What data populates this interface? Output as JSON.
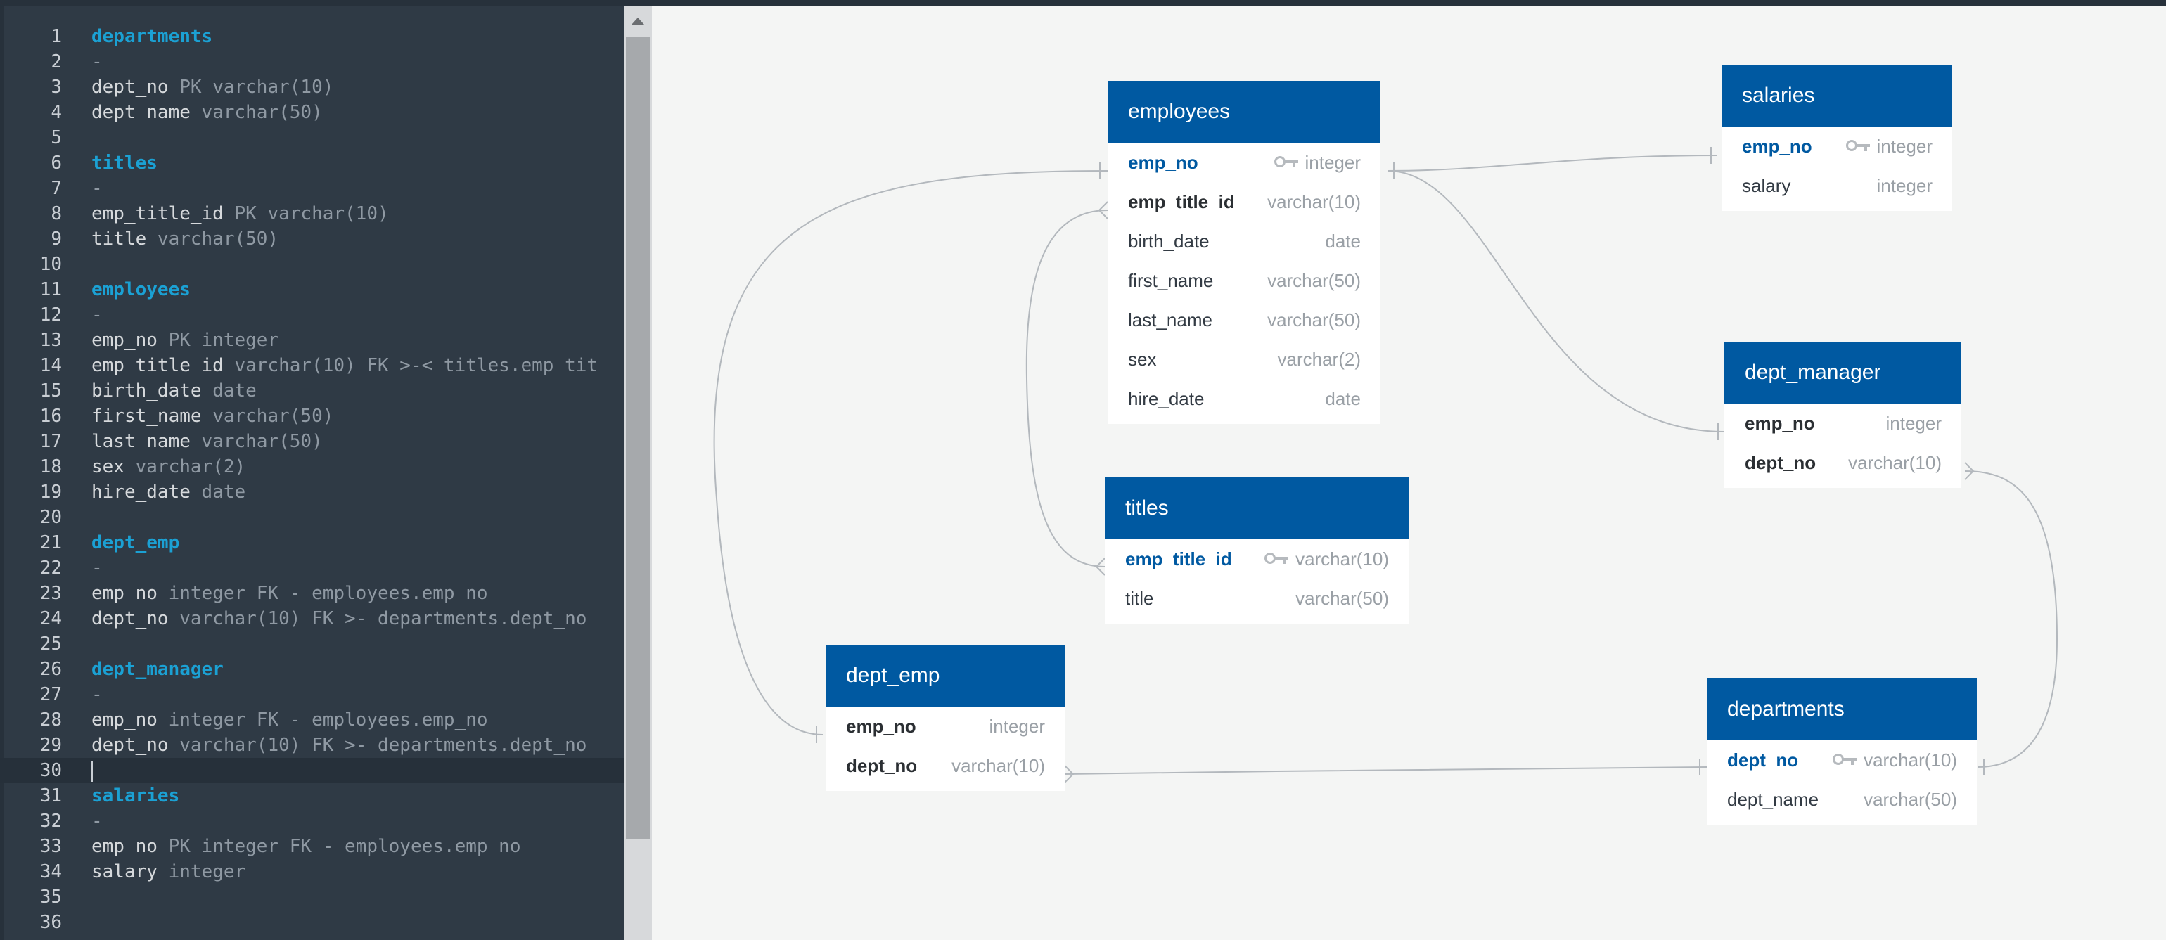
{
  "editor": {
    "lines": [
      {
        "n": "1",
        "tokens": [
          {
            "t": "departments",
            "k": "table"
          }
        ]
      },
      {
        "n": "2",
        "tokens": [
          {
            "t": "-",
            "k": "dash"
          }
        ]
      },
      {
        "n": "3",
        "tokens": [
          {
            "t": "dept_no ",
            "k": "name"
          },
          {
            "t": "PK varchar(10)",
            "k": "type"
          }
        ]
      },
      {
        "n": "4",
        "tokens": [
          {
            "t": "dept_name ",
            "k": "name"
          },
          {
            "t": "varchar(50)",
            "k": "type"
          }
        ]
      },
      {
        "n": "5",
        "tokens": []
      },
      {
        "n": "6",
        "tokens": [
          {
            "t": "titles",
            "k": "table"
          }
        ]
      },
      {
        "n": "7",
        "tokens": [
          {
            "t": "-",
            "k": "dash"
          }
        ]
      },
      {
        "n": "8",
        "tokens": [
          {
            "t": "emp_title_id ",
            "k": "name"
          },
          {
            "t": "PK varchar(10)",
            "k": "type"
          }
        ]
      },
      {
        "n": "9",
        "tokens": [
          {
            "t": "title ",
            "k": "name"
          },
          {
            "t": "varchar(50)",
            "k": "type"
          }
        ]
      },
      {
        "n": "10",
        "tokens": []
      },
      {
        "n": "11",
        "tokens": [
          {
            "t": "employees",
            "k": "table"
          }
        ]
      },
      {
        "n": "12",
        "tokens": [
          {
            "t": "-",
            "k": "dash"
          }
        ]
      },
      {
        "n": "13",
        "tokens": [
          {
            "t": "emp_no ",
            "k": "name"
          },
          {
            "t": "PK integer",
            "k": "type"
          }
        ]
      },
      {
        "n": "14",
        "tokens": [
          {
            "t": "emp_title_id ",
            "k": "name"
          },
          {
            "t": "varchar(10) FK >-< titles.emp_tit",
            "k": "type"
          }
        ]
      },
      {
        "n": "15",
        "tokens": [
          {
            "t": "birth_date ",
            "k": "name"
          },
          {
            "t": "date",
            "k": "type"
          }
        ]
      },
      {
        "n": "16",
        "tokens": [
          {
            "t": "first_name ",
            "k": "name"
          },
          {
            "t": "varchar(50)",
            "k": "type"
          }
        ]
      },
      {
        "n": "17",
        "tokens": [
          {
            "t": "last_name ",
            "k": "name"
          },
          {
            "t": "varchar(50)",
            "k": "type"
          }
        ]
      },
      {
        "n": "18",
        "tokens": [
          {
            "t": "sex ",
            "k": "name"
          },
          {
            "t": "varchar(2)",
            "k": "type"
          }
        ]
      },
      {
        "n": "19",
        "tokens": [
          {
            "t": "hire_date ",
            "k": "name"
          },
          {
            "t": "date",
            "k": "type"
          }
        ]
      },
      {
        "n": "20",
        "tokens": []
      },
      {
        "n": "21",
        "tokens": [
          {
            "t": "dept_emp",
            "k": "table"
          }
        ]
      },
      {
        "n": "22",
        "tokens": [
          {
            "t": "-",
            "k": "dash"
          }
        ]
      },
      {
        "n": "23",
        "tokens": [
          {
            "t": "emp_no ",
            "k": "name"
          },
          {
            "t": "integer FK - employees.emp_no",
            "k": "type"
          }
        ]
      },
      {
        "n": "24",
        "tokens": [
          {
            "t": "dept_no ",
            "k": "name"
          },
          {
            "t": "varchar(10) FK >- departments.dept_no",
            "k": "type"
          }
        ]
      },
      {
        "n": "25",
        "tokens": []
      },
      {
        "n": "26",
        "tokens": [
          {
            "t": "dept_manager",
            "k": "table"
          }
        ]
      },
      {
        "n": "27",
        "tokens": [
          {
            "t": "-",
            "k": "dash"
          }
        ]
      },
      {
        "n": "28",
        "tokens": [
          {
            "t": "emp_no ",
            "k": "name"
          },
          {
            "t": "integer FK - employees.emp_no",
            "k": "type"
          }
        ]
      },
      {
        "n": "29",
        "tokens": [
          {
            "t": "dept_no ",
            "k": "name"
          },
          {
            "t": "varchar(10) FK >- departments.dept_no",
            "k": "type"
          }
        ]
      },
      {
        "n": "30",
        "tokens": [],
        "active": true
      },
      {
        "n": "31",
        "tokens": [
          {
            "t": "salaries",
            "k": "table"
          }
        ]
      },
      {
        "n": "32",
        "tokens": [
          {
            "t": "-",
            "k": "dash"
          }
        ]
      },
      {
        "n": "33",
        "tokens": [
          {
            "t": "emp_no ",
            "k": "name"
          },
          {
            "t": "PK integer FK - employees.emp_no",
            "k": "type"
          }
        ]
      },
      {
        "n": "34",
        "tokens": [
          {
            "t": "salary ",
            "k": "name"
          },
          {
            "t": "integer",
            "k": "type"
          }
        ]
      },
      {
        "n": "35",
        "tokens": []
      },
      {
        "n": "36",
        "tokens": []
      }
    ]
  },
  "diagram": {
    "colors": {
      "header": "#0059a1",
      "pk_text": "#0059a1",
      "relation_line": "#b3b8bd"
    },
    "tables": {
      "employees": {
        "name": "employees",
        "fields": [
          {
            "name": "emp_no",
            "type": "integer",
            "pk": true
          },
          {
            "name": "emp_title_id",
            "type": "varchar(10)",
            "fk": true
          },
          {
            "name": "birth_date",
            "type": "date"
          },
          {
            "name": "first_name",
            "type": "varchar(50)"
          },
          {
            "name": "last_name",
            "type": "varchar(50)"
          },
          {
            "name": "sex",
            "type": "varchar(2)"
          },
          {
            "name": "hire_date",
            "type": "date"
          }
        ]
      },
      "salaries": {
        "name": "salaries",
        "fields": [
          {
            "name": "emp_no",
            "type": "integer",
            "pk": true
          },
          {
            "name": "salary",
            "type": "integer"
          }
        ]
      },
      "dept_manager": {
        "name": "dept_manager",
        "fields": [
          {
            "name": "emp_no",
            "type": "integer",
            "fk": true
          },
          {
            "name": "dept_no",
            "type": "varchar(10)",
            "fk": true
          }
        ]
      },
      "titles": {
        "name": "titles",
        "fields": [
          {
            "name": "emp_title_id",
            "type": "varchar(10)",
            "pk": true
          },
          {
            "name": "title",
            "type": "varchar(50)"
          }
        ]
      },
      "dept_emp": {
        "name": "dept_emp",
        "fields": [
          {
            "name": "emp_no",
            "type": "integer",
            "fk": true
          },
          {
            "name": "dept_no",
            "type": "varchar(10)",
            "fk": true
          }
        ]
      },
      "departments": {
        "name": "departments",
        "fields": [
          {
            "name": "dept_no",
            "type": "varchar(10)",
            "pk": true
          },
          {
            "name": "dept_name",
            "type": "varchar(50)"
          }
        ]
      }
    }
  }
}
